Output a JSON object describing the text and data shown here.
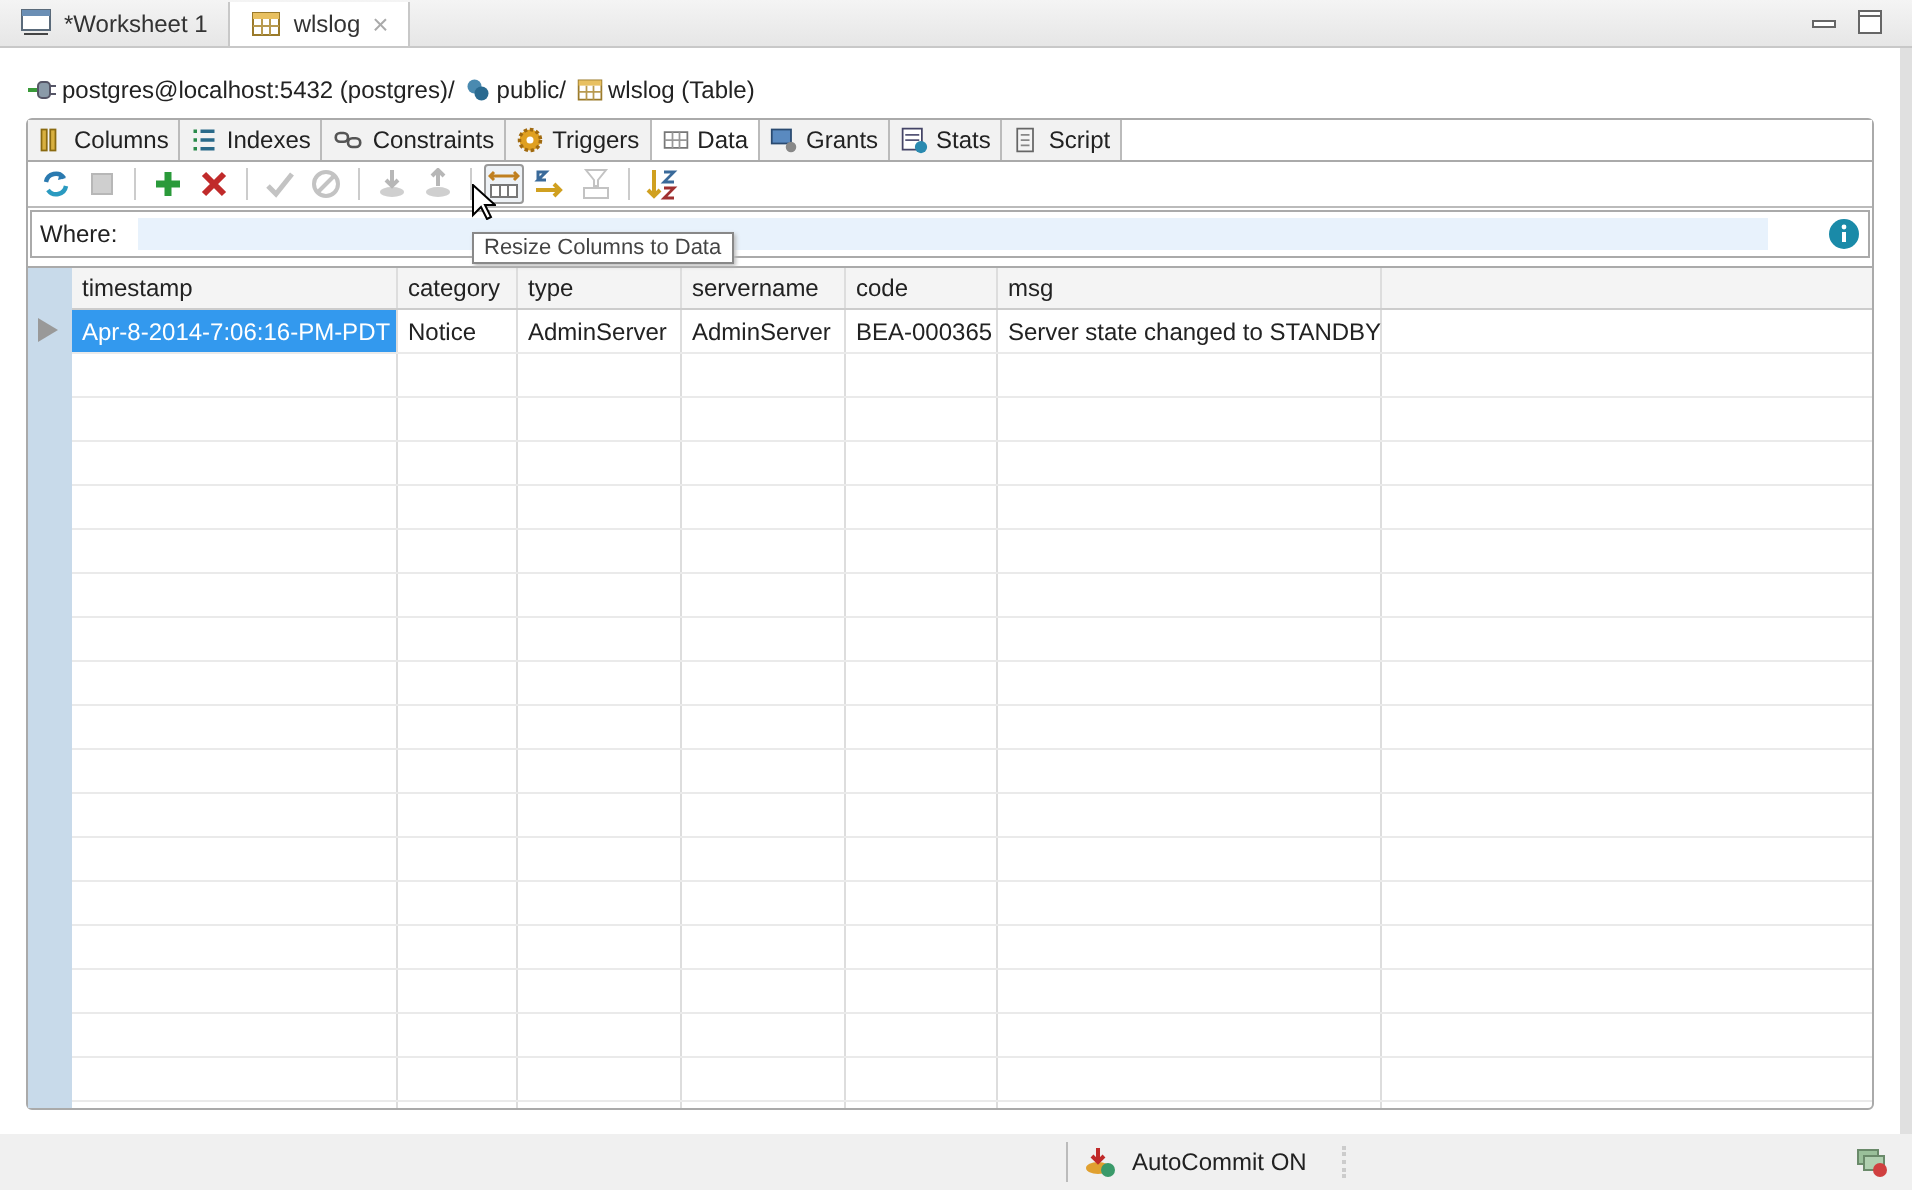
{
  "editor_tabs": [
    {
      "label": "*Worksheet 1",
      "kind": "sql",
      "selected": false,
      "closable": false
    },
    {
      "label": "wlslog",
      "kind": "table",
      "selected": true,
      "closable": true
    }
  ],
  "close_glyph": "×",
  "breadcrumb": {
    "connection": "postgres@localhost:5432 (postgres)/",
    "schema": "public/",
    "table": "wlslog (Table)"
  },
  "tabs": [
    {
      "label": "Columns",
      "kind": "columns",
      "selected": false
    },
    {
      "label": "Indexes",
      "kind": "indexes",
      "selected": false
    },
    {
      "label": "Constraints",
      "kind": "constraints",
      "selected": false
    },
    {
      "label": "Triggers",
      "kind": "triggers",
      "selected": false
    },
    {
      "label": "Data",
      "kind": "data",
      "selected": true
    },
    {
      "label": "Grants",
      "kind": "grants",
      "selected": false
    },
    {
      "label": "Stats",
      "kind": "stats",
      "selected": false
    },
    {
      "label": "Script",
      "kind": "script",
      "selected": false
    }
  ],
  "toolbar": [
    [
      {
        "kind": "refresh",
        "disabled": false,
        "hovered": false
      },
      {
        "kind": "stop",
        "disabled": true,
        "hovered": false
      }
    ],
    [
      {
        "kind": "add",
        "disabled": false,
        "hovered": false
      },
      {
        "kind": "delete",
        "disabled": false,
        "hovered": false
      }
    ],
    [
      {
        "kind": "commit",
        "disabled": true,
        "hovered": false
      },
      {
        "kind": "cancel",
        "disabled": true,
        "hovered": false
      }
    ],
    [
      {
        "kind": "import",
        "disabled": true,
        "hovered": false
      },
      {
        "kind": "export",
        "disabled": true,
        "hovered": false
      }
    ],
    [
      {
        "kind": "resize",
        "disabled": false,
        "hovered": true
      },
      {
        "kind": "sort",
        "disabled": false,
        "hovered": false
      },
      {
        "kind": "filter",
        "disabled": true,
        "hovered": false
      }
    ],
    [
      {
        "kind": "sortaz",
        "disabled": false,
        "hovered": false
      }
    ]
  ],
  "tooltip": "Resize Columns to Data",
  "where": {
    "label": "Where:"
  },
  "table": {
    "columns": [
      "timestamp",
      "category",
      "type",
      "servername",
      "code",
      "msg"
    ],
    "rows": [
      {
        "current": true,
        "cells": [
          {
            "text": "Apr-8-2014-7:06:16-PM-PDT",
            "selected": true
          },
          {
            "text": "Notice",
            "selected": false
          },
          {
            "text": "AdminServer",
            "selected": false
          },
          {
            "text": "AdminServer",
            "selected": false
          },
          {
            "text": "BEA-000365",
            "selected": false
          },
          {
            "text": "Server state changed to STANDBY",
            "selected": false
          }
        ]
      }
    ]
  },
  "status_bar": {
    "autocommit": "AutoCommit ON"
  }
}
